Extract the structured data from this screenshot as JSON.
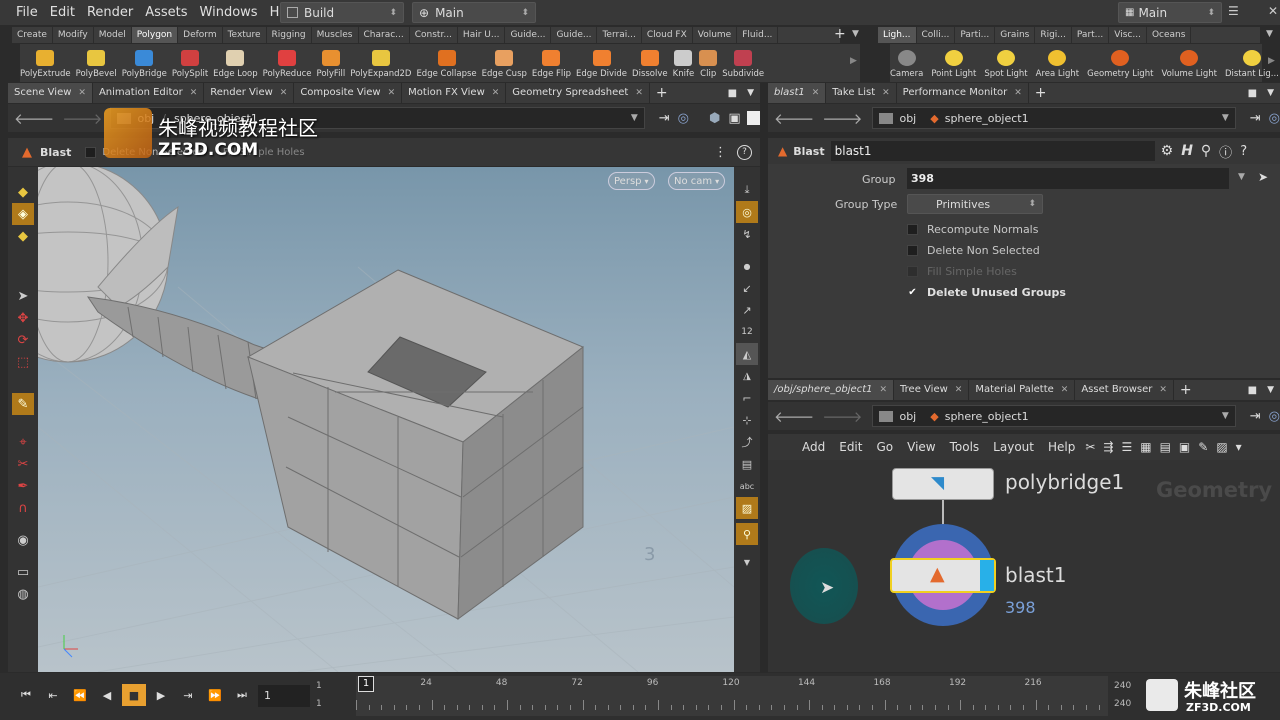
{
  "menubar": {
    "items": [
      "File",
      "Edit",
      "Render",
      "Assets",
      "Windows",
      "Help"
    ],
    "desktop_build": "Build",
    "desktop_main": "Main",
    "desktop_right": "Main"
  },
  "shelf_tabs_left": [
    "Create",
    "Modify",
    "Model",
    "Polygon",
    "Deform",
    "Texture",
    "Rigging",
    "Muscles",
    "Charac...",
    "Constr...",
    "Hair U...",
    "Guide...",
    "Guide...",
    "Terrai...",
    "Cloud FX",
    "Volume",
    "Fluid..."
  ],
  "shelf_tabs_right": [
    "Ligh...",
    "Colli...",
    "Parti...",
    "Grains",
    "Rigi...",
    "Part...",
    "Visc...",
    "Oceans"
  ],
  "shelf_tools_left": [
    "PolyExtrude",
    "PolyBevel",
    "PolyBridge",
    "PolySplit",
    "Edge Loop",
    "PolyReduce",
    "PolyFill",
    "PolyExpand2D",
    "Edge Collapse",
    "Edge Cusp",
    "Edge Flip",
    "Edge Divide",
    "Dissolve",
    "Knife",
    "Clip",
    "Subdivide"
  ],
  "shelf_tools_right": [
    "Camera",
    "Point Light",
    "Spot Light",
    "Area Light",
    "Geometry Light",
    "Volume Light",
    "Distant Lig..."
  ],
  "left_pane": {
    "tabs": [
      "Scene View",
      "Animation Editor",
      "Render View",
      "Composite View",
      "Motion FX View",
      "Geometry Spreadsheet"
    ],
    "path_root": "obj",
    "path_child": "sphere_object1",
    "op_title": "Blast",
    "op_delete_nonsel": "Delete Non Selected",
    "op_fill": "Fill Simple Holes",
    "persp": "Persp",
    "nocam": "No cam",
    "viewport_number": "3"
  },
  "watermark": {
    "title": "朱峰视频教程社区",
    "url": "ZF3D.COM",
    "bottom_title": "朱峰社区",
    "bottom_url": "ZF3D.COM"
  },
  "parm_pane": {
    "tabs": [
      "blast1",
      "Take List",
      "Performance Monitor"
    ],
    "path_root": "obj",
    "path_child": "sphere_object1",
    "node_type": "Blast",
    "node_name": "blast1",
    "group_label": "Group",
    "group_value": "398",
    "group_type_label": "Group Type",
    "group_type_value": "Primitives",
    "checkboxes": [
      {
        "label": "Recompute Normals",
        "checked": false
      },
      {
        "label": "Delete Non Selected",
        "checked": false
      },
      {
        "label": "Fill Simple Holes",
        "checked": false
      },
      {
        "label": "Delete Unused Groups",
        "checked": true
      }
    ]
  },
  "network_pane": {
    "tabs": [
      "/obj/sphere_object1",
      "Tree View",
      "Material Palette",
      "Asset Browser"
    ],
    "path_root": "obj",
    "path_child": "sphere_object1",
    "menu": [
      "Add",
      "Edit",
      "Go",
      "View",
      "Tools",
      "Layout",
      "Help"
    ],
    "context_label": "Geometry",
    "nodes": [
      {
        "name": "polybridge1",
        "info": ""
      },
      {
        "name": "blast1",
        "info": "398"
      }
    ]
  },
  "timeline": {
    "current_frame": "1",
    "start_top": "1",
    "start_bottom": "1",
    "end_top": "240",
    "end_bottom": "240",
    "marker": "1",
    "ticks": [
      "24",
      "48",
      "72",
      "96",
      "120",
      "144",
      "168",
      "192",
      "216"
    ]
  }
}
